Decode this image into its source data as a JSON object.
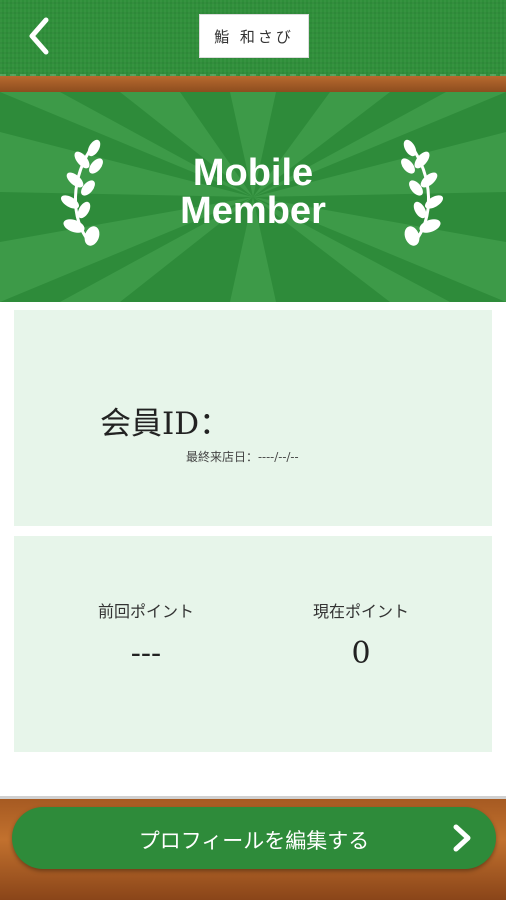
{
  "header": {
    "logo_text": "鮨 和さび"
  },
  "banner": {
    "title_line1": "Mobile",
    "title_line2": "Member"
  },
  "member": {
    "id_label": "会員ID：",
    "last_visit": "最終来店日：----/--/--"
  },
  "points": {
    "previous_label": "前回ポイント",
    "previous_value": "---",
    "current_label": "現在ポイント",
    "current_value": "0"
  },
  "footer": {
    "edit_profile_label": "プロフィールを編集する"
  },
  "colors": {
    "primary_green": "#2e8b3a",
    "card_bg": "#e7f5ea",
    "wood": "#a65a22"
  }
}
